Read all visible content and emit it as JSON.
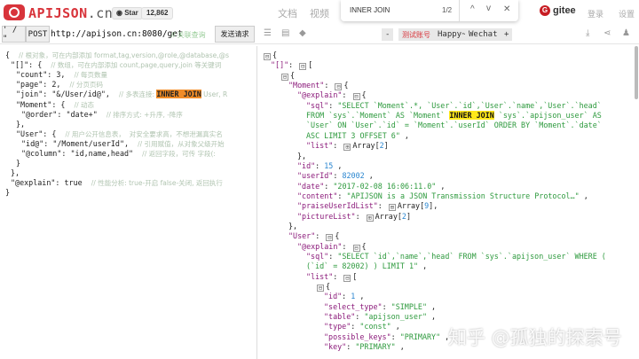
{
  "header": {
    "brand": "APIJSON",
    "brand_suffix": ".cn",
    "star_label": "Star",
    "star_count": "12,862",
    "nav": [
      "文档",
      "视频"
    ],
    "gitee": "gitee",
    "login": "登录",
    "settings": "设置"
  },
  "find": {
    "query": "INNER JOIN",
    "count": "1/2",
    "prev": "^",
    "next": "v",
    "close": "✕"
  },
  "toolbar": {
    "quote_toggle": "' / \"",
    "method": "POST",
    "url": "http://apijson.cn:8080/get",
    "url_comment": "// 关联查询",
    "send": "发送请求",
    "account_minus": "-",
    "account_label": "测试账号",
    "account_name": "Happy~",
    "account_type": "Wechat",
    "account_plus": "+"
  },
  "colors": {
    "brand": "#d8343b",
    "key": "#8b1a7a",
    "string": "#2e9a3e",
    "number": "#2a86d0",
    "highlight_current": "#f08c28",
    "highlight_other": "#ffe81a"
  },
  "request_lines": [
    [
      0,
      [
        [
          "p",
          "{  "
        ],
        [
          "c",
          "// 根对象，可在内部添加 format,tag,version,@role,@database,@s"
        ]
      ]
    ],
    [
      1,
      [
        [
          "k",
          "\"[]\""
        ],
        [
          "p",
          ": {  "
        ],
        [
          "c",
          "// 数组，可在内部添加 count,page,query,join 等关键词"
        ]
      ]
    ],
    [
      2,
      [
        [
          "k",
          "\"count\""
        ],
        [
          "p",
          ": 3,  "
        ],
        [
          "c",
          "// 每页数量"
        ]
      ]
    ],
    [
      2,
      [
        [
          "k",
          "\"page\""
        ],
        [
          "p",
          ": 2,  "
        ],
        [
          "c",
          "// 分页页码"
        ]
      ]
    ],
    [
      2,
      [
        [
          "k",
          "\"join\""
        ],
        [
          "p",
          ": "
        ],
        [
          "s",
          "\"&/User/id@\""
        ],
        [
          "p",
          ",  "
        ],
        [
          "c",
          "// 多表连接: "
        ],
        [
          "hl",
          "INNER JOIN"
        ],
        [
          "c",
          " User, R"
        ]
      ]
    ],
    [
      2,
      [
        [
          "k",
          "\"Moment\""
        ],
        [
          "p",
          ": {  "
        ],
        [
          "c",
          "// 动态"
        ]
      ]
    ],
    [
      3,
      [
        [
          "k",
          "\"@order\""
        ],
        [
          "p",
          ": "
        ],
        [
          "s",
          "\"date+\""
        ],
        [
          "p",
          "  "
        ],
        [
          "c",
          "// 排序方式: +升序, -降序"
        ]
      ]
    ],
    [
      2,
      [
        [
          "p",
          "},"
        ]
      ]
    ],
    [
      2,
      [
        [
          "k",
          "\"User\""
        ],
        [
          "p",
          ": {  "
        ],
        [
          "c",
          "// 用户公开信息表，  对安全要求高，不想泄漏真实名"
        ]
      ]
    ],
    [
      3,
      [
        [
          "k",
          "\"id@\""
        ],
        [
          "p",
          ": "
        ],
        [
          "s",
          "\"/Moment/userId\""
        ],
        [
          "p",
          ",  "
        ],
        [
          "c",
          "// 引用赋值，从对象父级开始"
        ]
      ]
    ],
    [
      3,
      [
        [
          "k",
          "\"@column\""
        ],
        [
          "p",
          ": "
        ],
        [
          "s",
          "\"id,name,head\""
        ],
        [
          "p",
          "  "
        ],
        [
          "c",
          "// 返回字段，可传 字段(:"
        ]
      ]
    ],
    [
      2,
      [
        [
          "p",
          "}"
        ]
      ]
    ],
    [
      1,
      [
        [
          "p",
          "},"
        ]
      ]
    ],
    [
      1,
      [
        [
          "k",
          "\"@explain\""
        ],
        [
          "p",
          ": true  "
        ],
        [
          "c",
          "// 性能分析: true-开启 false-关闭, 返回执行"
        ]
      ]
    ],
    [
      0,
      [
        [
          "p",
          "}"
        ]
      ]
    ]
  ],
  "response_lines": [
    [
      0,
      [
        [
          "t",
          "⊟"
        ],
        [
          "p",
          "{"
        ]
      ]
    ],
    [
      1,
      [
        [
          "k",
          "\"[]\""
        ],
        [
          "p",
          ": "
        ],
        [
          "t",
          "⊟"
        ],
        [
          "p",
          "["
        ]
      ]
    ],
    [
      2,
      [
        [
          "t",
          "⊟"
        ],
        [
          "p",
          "{"
        ]
      ]
    ],
    [
      3,
      [
        [
          "k",
          "\"Moment\""
        ],
        [
          "p",
          ": "
        ],
        [
          "t",
          "⊟"
        ],
        [
          "p",
          "{"
        ]
      ]
    ],
    [
      4,
      [
        [
          "k",
          "\"@explain\""
        ],
        [
          "p",
          ": "
        ],
        [
          "t",
          "⊟"
        ],
        [
          "p",
          "{"
        ]
      ]
    ],
    [
      5,
      [
        [
          "k",
          "\"sql\""
        ],
        [
          "p",
          ": "
        ],
        [
          "s",
          "\"SELECT `Moment`.*, `User`.`id`,`User`.`name`,`User`.`head`"
        ]
      ]
    ],
    [
      5,
      [
        [
          "s",
          "FROM `sys`.`Moment` AS `Moment` "
        ],
        [
          "hy",
          "INNER JOIN"
        ],
        [
          "s",
          " `sys`.`apijson_user` AS"
        ]
      ]
    ],
    [
      5,
      [
        [
          "s",
          "`User` ON `User`.`id` = `Moment`.`userId` ORDER BY `Moment`.`date`"
        ]
      ]
    ],
    [
      5,
      [
        [
          "s",
          "ASC LIMIT 3 OFFSET 6\""
        ],
        [
          "p",
          " ,"
        ]
      ]
    ],
    [
      5,
      [
        [
          "k",
          "\"list\""
        ],
        [
          "p",
          ": "
        ],
        [
          "t",
          "⊞"
        ],
        [
          "p",
          "Array["
        ],
        [
          "n",
          "2"
        ],
        [
          "p",
          "]"
        ]
      ]
    ],
    [
      4,
      [
        [
          "p",
          "},"
        ]
      ]
    ],
    [
      4,
      [
        [
          "k",
          "\"id\""
        ],
        [
          "p",
          ": "
        ],
        [
          "n",
          "15"
        ],
        [
          "p",
          " ,"
        ]
      ]
    ],
    [
      4,
      [
        [
          "k",
          "\"userId\""
        ],
        [
          "p",
          ": "
        ],
        [
          "n",
          "82002"
        ],
        [
          "p",
          " ,"
        ]
      ]
    ],
    [
      4,
      [
        [
          "k",
          "\"date\""
        ],
        [
          "p",
          ": "
        ],
        [
          "s",
          "\"2017-02-08 16:06:11.0\""
        ],
        [
          "p",
          " ,"
        ]
      ]
    ],
    [
      4,
      [
        [
          "k",
          "\"content\""
        ],
        [
          "p",
          ": "
        ],
        [
          "s",
          "\"APIJSON is a JSON Transmission Structure Protocol…\""
        ],
        [
          "p",
          " ,"
        ]
      ]
    ],
    [
      4,
      [
        [
          "k",
          "\"praiseUserIdList\""
        ],
        [
          "p",
          ": "
        ],
        [
          "t",
          "⊞"
        ],
        [
          "p",
          "Array["
        ],
        [
          "n",
          "9"
        ],
        [
          "p",
          "],"
        ]
      ]
    ],
    [
      4,
      [
        [
          "k",
          "\"pictureList\""
        ],
        [
          "p",
          ": "
        ],
        [
          "t",
          "⊞"
        ],
        [
          "p",
          "Array["
        ],
        [
          "n",
          "2"
        ],
        [
          "p",
          "]"
        ]
      ]
    ],
    [
      3,
      [
        [
          "p",
          "},"
        ]
      ]
    ],
    [
      3,
      [
        [
          "k",
          "\"User\""
        ],
        [
          "p",
          ": "
        ],
        [
          "t",
          "⊟"
        ],
        [
          "p",
          "{"
        ]
      ]
    ],
    [
      4,
      [
        [
          "k",
          "\"@explain\""
        ],
        [
          "p",
          ": "
        ],
        [
          "t",
          "⊟"
        ],
        [
          "p",
          "{"
        ]
      ]
    ],
    [
      5,
      [
        [
          "k",
          "\"sql\""
        ],
        [
          "p",
          ": "
        ],
        [
          "s",
          "\"SELECT `id`,`name`,`head` FROM `sys`.`apijson_user` WHERE ("
        ]
      ]
    ],
    [
      5,
      [
        [
          "s",
          "(`id` = 82002) ) LIMIT 1\""
        ],
        [
          "p",
          " ,"
        ]
      ]
    ],
    [
      5,
      [
        [
          "k",
          "\"list\""
        ],
        [
          "p",
          ": "
        ],
        [
          "t",
          "⊟"
        ],
        [
          "p",
          "["
        ]
      ]
    ],
    [
      6,
      [
        [
          "t",
          "⊟"
        ],
        [
          "p",
          "{"
        ]
      ]
    ],
    [
      7,
      [
        [
          "k",
          "\"id\""
        ],
        [
          "p",
          ": "
        ],
        [
          "n",
          "1"
        ],
        [
          "p",
          " ,"
        ]
      ]
    ],
    [
      7,
      [
        [
          "k",
          "\"select_type\""
        ],
        [
          "p",
          ": "
        ],
        [
          "s",
          "\"SIMPLE\""
        ],
        [
          "p",
          " ,"
        ]
      ]
    ],
    [
      7,
      [
        [
          "k",
          "\"table\""
        ],
        [
          "p",
          ": "
        ],
        [
          "s",
          "\"apijson_user\""
        ],
        [
          "p",
          " ,"
        ]
      ]
    ],
    [
      7,
      [
        [
          "k",
          "\"type\""
        ],
        [
          "p",
          ": "
        ],
        [
          "s",
          "\"const\""
        ],
        [
          "p",
          " ,"
        ]
      ]
    ],
    [
      7,
      [
        [
          "k",
          "\"possible_keys\""
        ],
        [
          "p",
          ": "
        ],
        [
          "s",
          "\"PRIMARY\""
        ],
        [
          "p",
          " ,"
        ]
      ]
    ],
    [
      7,
      [
        [
          "k",
          "\"key\""
        ],
        [
          "p",
          ": "
        ],
        [
          "s",
          "\"PRIMARY\""
        ],
        [
          "p",
          " ,"
        ]
      ]
    ]
  ],
  "watermark": "知乎 @孤独的探索号"
}
